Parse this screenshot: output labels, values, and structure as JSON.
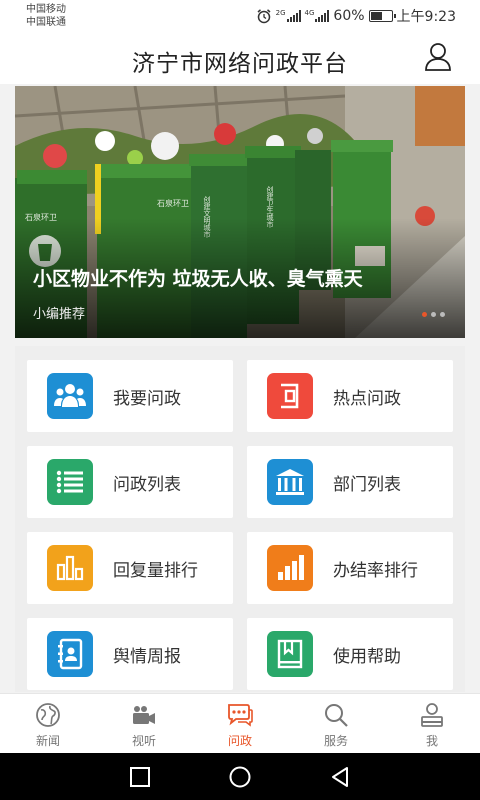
{
  "status": {
    "carrier1": "中国移动",
    "carrier2": "中国联通",
    "sig1_tag": "2G",
    "sig2_tag": "4G",
    "battery": "60%",
    "battery_level": 0.6,
    "time": "上午9:23"
  },
  "header": {
    "title": "济宁市网络问政平台",
    "profile_icon": "user-icon"
  },
  "banner": {
    "title": "小区物业不作为 垃圾无人收、臭气熏天",
    "subtitle": "小编推荐",
    "slide_index": 0,
    "slide_count": 3,
    "bin_text_1": "石泉环卫",
    "bin_text_2": "石泉环卫",
    "bin_text_3": "创建文明城市",
    "bin_text_4": "创建卫生城市"
  },
  "menu": [
    {
      "label": "我要问政",
      "icon": "users-icon",
      "color": "#1e8fd4"
    },
    {
      "label": "热点问政",
      "icon": "hot-topic-icon",
      "color": "#ef4a3c"
    },
    {
      "label": "问政列表",
      "icon": "list-icon",
      "color": "#2aa86a"
    },
    {
      "label": "部门列表",
      "icon": "building-icon",
      "color": "#1e8fd4"
    },
    {
      "label": "回复量排行",
      "icon": "bar-chart-icon",
      "color": "#f2a21b"
    },
    {
      "label": "办结率排行",
      "icon": "rising-chart-icon",
      "color": "#f07d1a"
    },
    {
      "label": "舆情周报",
      "icon": "contacts-book-icon",
      "color": "#1e8fd4"
    },
    {
      "label": "使用帮助",
      "icon": "help-book-icon",
      "color": "#2aa86a"
    }
  ],
  "tabs": [
    {
      "label": "新闻",
      "icon": "globe-icon"
    },
    {
      "label": "视听",
      "icon": "video-camera-icon"
    },
    {
      "label": "问政",
      "icon": "chat-icon",
      "active": true
    },
    {
      "label": "服务",
      "icon": "search-icon"
    },
    {
      "label": "我",
      "icon": "person-icon"
    }
  ],
  "colors": {
    "accent": "#e8562a",
    "tab_inactive": "#777777"
  }
}
